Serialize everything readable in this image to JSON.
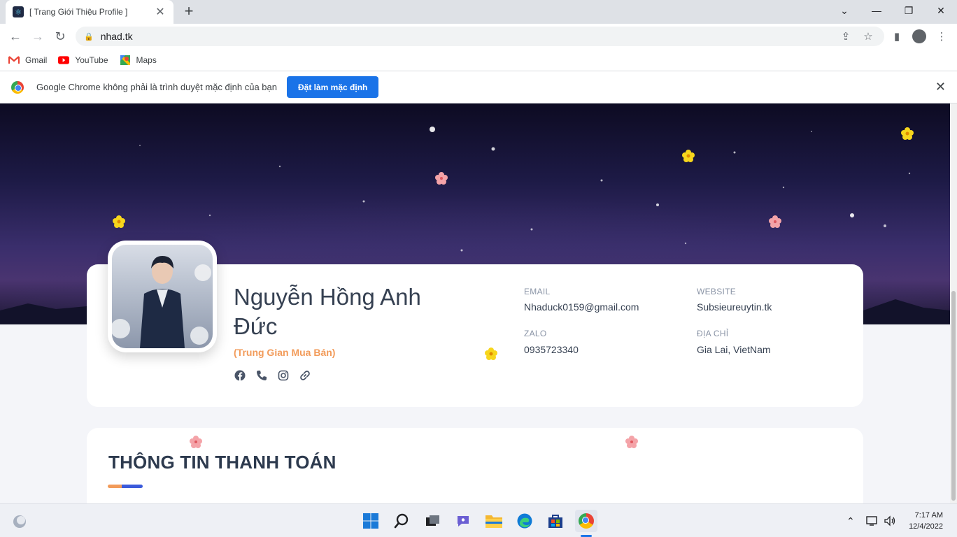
{
  "browser": {
    "tab_title": "[ Trang Giới Thiệu Profile ]",
    "url": "nhad.tk",
    "bookmarks": [
      {
        "label": "Gmail",
        "icon": "gmail-icon"
      },
      {
        "label": "YouTube",
        "icon": "youtube-icon"
      },
      {
        "label": "Maps",
        "icon": "maps-icon"
      }
    ],
    "infobar": {
      "message": "Google Chrome không phải là trình duyệt mặc định của bạn",
      "button": "Đặt làm mặc định"
    }
  },
  "profile": {
    "name": "Nguyễn Hồng Anh Đức",
    "role": "(Trung Gian Mua Bán)",
    "socials": [
      "facebook-icon",
      "phone-icon",
      "instagram-icon",
      "link-icon"
    ],
    "fields": {
      "email": {
        "label": "EMAIL",
        "value": "Nhaduck0159@gmail.com"
      },
      "website": {
        "label": "WEBSITE",
        "value": "Subsieureuytin.tk"
      },
      "zalo": {
        "label": "ZALO",
        "value": "0935723340"
      },
      "address": {
        "label": "ĐỊA CHỈ",
        "value": "Gia Lai, VietNam"
      }
    }
  },
  "payment": {
    "title": "THÔNG TIN THANH TOÁN"
  },
  "taskbar": {
    "time": "7:17 AM",
    "date": "12/4/2022"
  },
  "colors": {
    "accent": "#f29b5a",
    "brand_blue": "#1a73e8",
    "text_dark": "#364152"
  }
}
